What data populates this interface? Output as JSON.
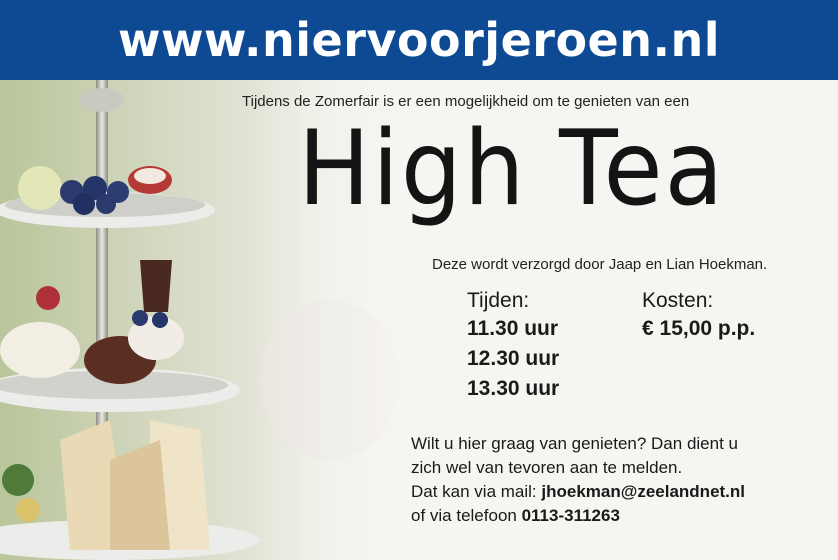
{
  "banner": {
    "url": "www.niervoorjeroen.nl"
  },
  "intro": "Tijdens de Zomerfair is er een mogelijkheid om te genieten van een",
  "headline": "High Tea",
  "subline": "Deze wordt verzorgd door Jaap en Lian Hoekman.",
  "times": {
    "heading": "Tijden:",
    "values": [
      "11.30 uur",
      "12.30 uur",
      "13.30 uur"
    ]
  },
  "cost": {
    "heading": "Kosten:",
    "value": "€ 15,00 p.p."
  },
  "contact": {
    "line1": "Wilt u hier graag van genieten? Dan dient u",
    "line2": "zich wel van tevoren aan te melden.",
    "mail_prefix": "Dat kan via mail: ",
    "mail": "jhoekman@zeelandnet.nl",
    "phone_prefix": "of via telefoon ",
    "phone": "0113-311263"
  },
  "colors": {
    "banner": "#0e4a94",
    "banner_text": "#ffffff",
    "background": "#f7f5f1"
  }
}
